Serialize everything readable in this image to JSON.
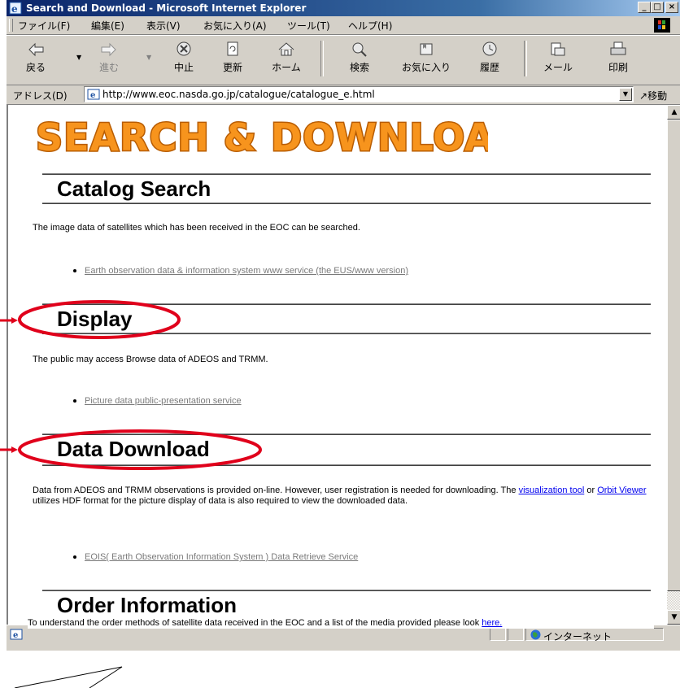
{
  "window": {
    "title": "Search and Download - Microsoft Internet Explorer",
    "controls": [
      "_",
      "□",
      "×"
    ]
  },
  "menu": {
    "items": [
      "ファイル(F)",
      "編集(E)",
      "表示(V)",
      "お気に入り(A)",
      "ツール(T)",
      "ヘルプ(H)"
    ]
  },
  "toolbar": {
    "back": "戻る",
    "forward": "進む",
    "stop": "中止",
    "refresh": "更新",
    "home": "ホーム",
    "search": "検索",
    "favorites": "お気に入り",
    "history": "履歴",
    "mail": "メール",
    "print": "印刷"
  },
  "address": {
    "label": "アドレス(D)",
    "url": "http://www.eoc.nasda.go.jp/catalogue/catalogue_e.html",
    "go": "移動"
  },
  "page": {
    "banner": "SEARCH & DOWNLOAD",
    "sections": [
      {
        "heading": "Catalog Search",
        "text": "The image data of satellites which has been received in the EOC can be searched.",
        "link": "Earth observation data & information system www service (the EUS/www version)"
      },
      {
        "heading": "Display",
        "text": "The public may access Browse data of ADEOS and TRMM.",
        "link": "Picture data public-presentation service"
      },
      {
        "heading": "Data Download",
        "text_1": "Data from ADEOS and TRMM observations is provided on-line. However, user registration is needed for downloading. The ",
        "link_inline_1": "visualization tool",
        "text_2": " or ",
        "link_inline_2": "Orbit Viewer",
        "text_3": " utilizes HDF format for the picture display of data is also required to view the downloaded data.",
        "link": "EOIS( Earth Observation Information System ) Data Retrieve Service"
      },
      {
        "heading": "Order Information",
        "text": "To understand the order methods of satellite data received in the EOC and a list of the media provided please look ",
        "link": "here."
      }
    ]
  },
  "status": {
    "zone": "インターネット"
  },
  "colors": {
    "titlebar": "#0a246a",
    "annotation": "#e0001b",
    "banner_fill": "#f7941d"
  }
}
